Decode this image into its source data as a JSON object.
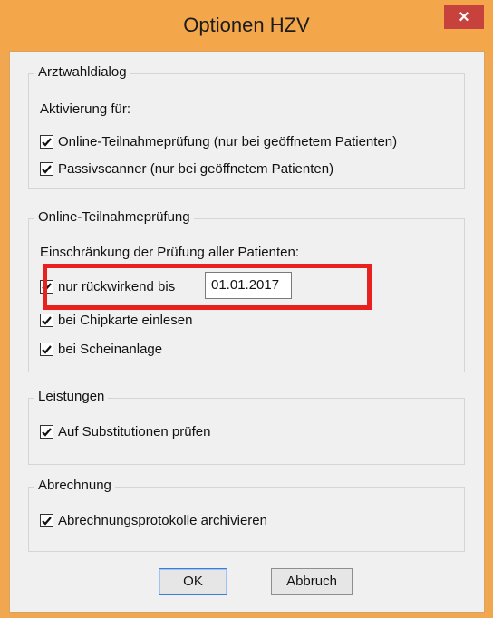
{
  "window": {
    "title": "Optionen HZV",
    "close_label": "×"
  },
  "groups": {
    "arztwahl": {
      "label": "Arztwahldialog",
      "subtitle": "Aktivierung für:",
      "options": [
        {
          "label": "Online-Teilnahmeprüfung (nur bei geöffnetem Patienten)",
          "checked": true
        },
        {
          "label": "Passivscanner (nur bei geöffnetem Patienten)",
          "checked": true
        }
      ]
    },
    "online": {
      "label": "Online-Teilnahmeprüfung",
      "subtitle": "Einschränkung der Prüfung aller Patienten:",
      "retro_label": "nur rückwirkend bis",
      "retro_checked": true,
      "retro_date": "01.01.2017",
      "options": [
        {
          "label": "bei Chipkarte einlesen",
          "checked": true
        },
        {
          "label": "bei Scheinanlage",
          "checked": true
        }
      ]
    },
    "leistungen": {
      "label": "Leistungen",
      "options": [
        {
          "label": "Auf Substitutionen prüfen",
          "checked": true
        }
      ]
    },
    "abrechnung": {
      "label": "Abrechnung",
      "options": [
        {
          "label": "Abrechnungsprotokolle archivieren",
          "checked": true
        }
      ]
    }
  },
  "buttons": {
    "ok_label": "OK",
    "cancel_label": "Abbruch"
  },
  "colors": {
    "title_bar": "#f3a64a",
    "close_button": "#c7423d",
    "highlight": "#e8211f",
    "dialog_bg": "#f0f0f0"
  }
}
